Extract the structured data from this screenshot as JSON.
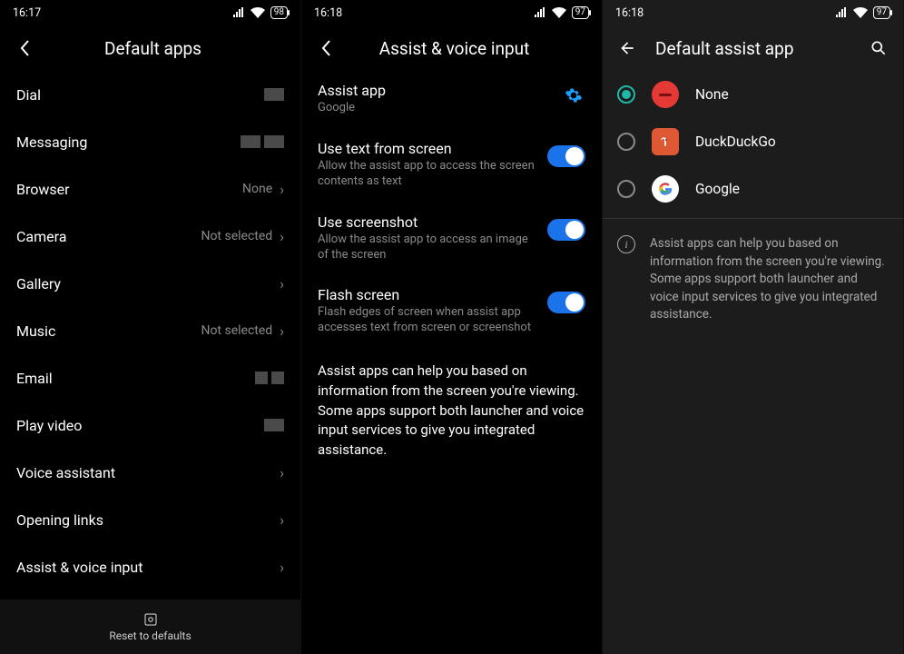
{
  "pane1": {
    "status": {
      "time": "16:17",
      "battery": "98"
    },
    "title": "Default apps",
    "items": [
      {
        "label": "Dial",
        "value": "",
        "chevron": false,
        "blocks": 1
      },
      {
        "label": "Messaging",
        "value": "",
        "chevron": false,
        "blocks": 2
      },
      {
        "label": "Browser",
        "value": "None",
        "chevron": true
      },
      {
        "label": "Camera",
        "value": "Not selected",
        "chevron": true
      },
      {
        "label": "Gallery",
        "value": "",
        "chevron": true
      },
      {
        "label": "Music",
        "value": "Not selected",
        "chevron": true
      },
      {
        "label": "Email",
        "value": "",
        "chevron": false,
        "blocks": 2,
        "small": true
      },
      {
        "label": "Play video",
        "value": "",
        "chevron": false,
        "blocks": 1
      },
      {
        "label": "Voice assistant",
        "value": "",
        "chevron": true
      },
      {
        "label": "Opening links",
        "value": "",
        "chevron": true
      },
      {
        "label": "Assist & voice input",
        "value": "",
        "chevron": true
      }
    ],
    "reset": "Reset to defaults"
  },
  "pane2": {
    "status": {
      "time": "16:18",
      "battery": "97"
    },
    "title": "Assist & voice input",
    "assist": {
      "title": "Assist app",
      "value": "Google"
    },
    "settings": [
      {
        "title": "Use text from screen",
        "sub": "Allow the assist app to access the screen contents as text"
      },
      {
        "title": "Use screenshot",
        "sub": "Allow the assist app to access an image of the screen"
      },
      {
        "title": "Flash screen",
        "sub": "Flash edges of screen when assist app accesses text from screen or screenshot"
      }
    ],
    "description": "Assist apps can help you based on information from the screen you're viewing. Some apps support both launcher and voice input services to give you integrated assistance."
  },
  "pane3": {
    "status": {
      "time": "16:18",
      "battery": "97"
    },
    "title": "Default assist app",
    "options": [
      {
        "label": "None",
        "checked": true
      },
      {
        "label": "DuckDuckGo",
        "checked": false
      },
      {
        "label": "Google",
        "checked": false
      }
    ],
    "info": "Assist apps can help you based on information from the screen you're viewing. Some apps support both launcher and voice input services to give you integrated assistance."
  }
}
